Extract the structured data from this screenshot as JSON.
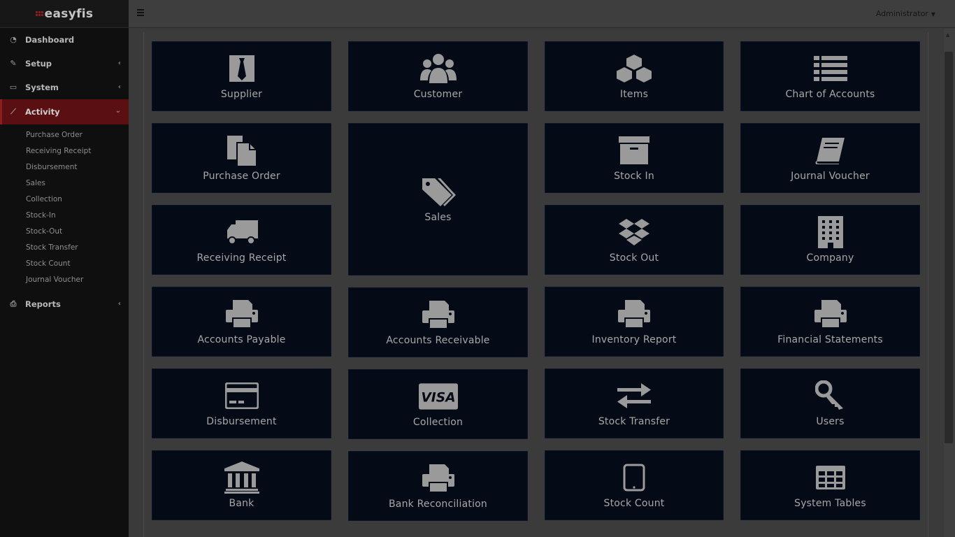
{
  "brand": {
    "name": "easyfis"
  },
  "topbar": {
    "user": "Administrator"
  },
  "sidebar": {
    "items": [
      {
        "label": "Dashboard"
      },
      {
        "label": "Setup"
      },
      {
        "label": "System"
      },
      {
        "label": "Activity"
      },
      {
        "label": "Reports"
      }
    ],
    "activity_submenu": [
      "Purchase Order",
      "Receiving Receipt",
      "Disbursement",
      "Sales",
      "Collection",
      "Stock-In",
      "Stock-Out",
      "Stock Transfer",
      "Stock Count",
      "Journal Voucher"
    ]
  },
  "tiles": [
    {
      "label": "Supplier",
      "icon": "tie-icon"
    },
    {
      "label": "Customer",
      "icon": "users-icon"
    },
    {
      "label": "Items",
      "icon": "cubes-icon"
    },
    {
      "label": "Chart of Accounts",
      "icon": "list-icon"
    },
    {
      "label": "Purchase Order",
      "icon": "files-icon"
    },
    {
      "label": "Sales",
      "icon": "tags-icon"
    },
    {
      "label": "Stock In",
      "icon": "archive-icon"
    },
    {
      "label": "Journal Voucher",
      "icon": "book-icon"
    },
    {
      "label": "Receiving Receipt",
      "icon": "truck-icon"
    },
    {
      "label": "Stock Out",
      "icon": "dropbox-icon"
    },
    {
      "label": "Company",
      "icon": "building-icon"
    },
    {
      "label": "Accounts Payable",
      "icon": "printer-icon"
    },
    {
      "label": "Accounts Receivable",
      "icon": "printer-icon"
    },
    {
      "label": "Inventory Report",
      "icon": "printer-icon"
    },
    {
      "label": "Financial Statements",
      "icon": "printer-icon"
    },
    {
      "label": "Disbursement",
      "icon": "credit-card-icon"
    },
    {
      "label": "Collection",
      "icon": "visa-icon"
    },
    {
      "label": "Stock Transfer",
      "icon": "exchange-icon"
    },
    {
      "label": "Users",
      "icon": "key-icon"
    },
    {
      "label": "Bank",
      "icon": "bank-icon"
    },
    {
      "label": "Bank Reconciliation",
      "icon": "printer-icon"
    },
    {
      "label": "Stock Count",
      "icon": "tablet-icon"
    },
    {
      "label": "System Tables",
      "icon": "table-icon"
    }
  ]
}
